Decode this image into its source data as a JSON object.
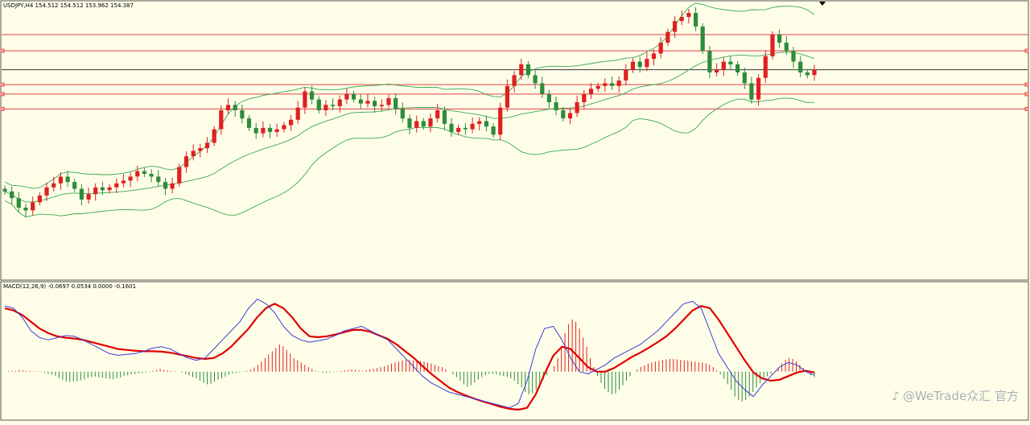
{
  "price_header": "USDJPY,H4  154.512 154.512 153.962 154.387",
  "macd_header": "MACD(12,26,9) -0.0697 0.0534 0.0000 -0.1601",
  "watermark": "@WeTrade众汇 官方",
  "colors": {
    "background": "#fefee8",
    "bull": "#e02020",
    "bear": "#2e8b3a",
    "bands": "#3aa855",
    "macd_line": "#3b3bdb",
    "signal_line": "#e00000",
    "levels": "#e04040",
    "current_price": "#333333"
  },
  "chart_data": [
    {
      "type": "candlestick",
      "symbol": "USDJPY",
      "timeframe": "H4",
      "ylim": [
        147.3,
        157.3
      ],
      "bollinger_bands": true,
      "horizontal_levels": [
        156.2,
        155.6,
        154.35,
        154.0,
        153.45
      ],
      "current_price_level": 154.9,
      "candles": [
        [
          150.5,
          150.4
        ],
        [
          150.4,
          150.15
        ],
        [
          150.15,
          149.8
        ],
        [
          149.8,
          149.7
        ],
        [
          149.7,
          150.0
        ],
        [
          150.0,
          150.25
        ],
        [
          150.25,
          150.55
        ],
        [
          150.55,
          150.7
        ],
        [
          150.7,
          150.95
        ],
        [
          150.95,
          150.75
        ],
        [
          150.75,
          150.5
        ],
        [
          150.5,
          150.1
        ],
        [
          150.1,
          150.3
        ],
        [
          150.3,
          150.55
        ],
        [
          150.55,
          150.45
        ],
        [
          150.45,
          150.55
        ],
        [
          150.55,
          150.7
        ],
        [
          150.7,
          150.8
        ],
        [
          150.8,
          150.95
        ],
        [
          150.95,
          151.15
        ],
        [
          151.15,
          151.05
        ],
        [
          151.05,
          150.95
        ],
        [
          150.95,
          150.75
        ],
        [
          150.75,
          150.5
        ],
        [
          150.5,
          150.7
        ],
        [
          150.7,
          151.3
        ],
        [
          151.3,
          151.7
        ],
        [
          151.7,
          151.9
        ],
        [
          151.9,
          152.0
        ],
        [
          152.0,
          152.2
        ],
        [
          152.2,
          152.7
        ],
        [
          152.7,
          153.4
        ],
        [
          153.4,
          153.6
        ],
        [
          153.6,
          153.4
        ],
        [
          153.4,
          153.1
        ],
        [
          153.1,
          152.75
        ],
        [
          152.75,
          152.55
        ],
        [
          152.55,
          152.75
        ],
        [
          152.75,
          152.6
        ],
        [
          152.6,
          152.7
        ],
        [
          152.7,
          152.85
        ],
        [
          152.85,
          153.05
        ],
        [
          153.05,
          153.5
        ],
        [
          153.5,
          154.1
        ],
        [
          154.1,
          153.8
        ],
        [
          153.8,
          153.4
        ],
        [
          153.4,
          153.6
        ],
        [
          153.6,
          153.55
        ],
        [
          153.55,
          153.8
        ],
        [
          153.8,
          154.0
        ],
        [
          154.0,
          153.8
        ],
        [
          153.8,
          153.65
        ],
        [
          153.65,
          153.75
        ],
        [
          153.75,
          153.55
        ],
        [
          153.55,
          153.6
        ],
        [
          153.6,
          153.85
        ],
        [
          153.85,
          153.45
        ],
        [
          153.45,
          153.1
        ],
        [
          153.1,
          152.75
        ],
        [
          152.75,
          153.0
        ],
        [
          153.0,
          152.8
        ],
        [
          152.8,
          153.1
        ],
        [
          153.1,
          153.4
        ],
        [
          153.4,
          152.9
        ],
        [
          152.9,
          152.6
        ],
        [
          152.6,
          152.75
        ],
        [
          152.75,
          152.7
        ],
        [
          152.7,
          152.9
        ],
        [
          152.9,
          153.0
        ],
        [
          153.0,
          152.8
        ],
        [
          152.8,
          152.5
        ],
        [
          152.5,
          153.5
        ],
        [
          153.5,
          154.3
        ],
        [
          154.3,
          154.7
        ],
        [
          154.7,
          155.1
        ],
        [
          155.1,
          154.7
        ],
        [
          154.7,
          154.4
        ],
        [
          154.4,
          154.0
        ],
        [
          154.0,
          153.7
        ],
        [
          153.7,
          153.4
        ],
        [
          153.4,
          153.1
        ],
        [
          153.1,
          153.3
        ],
        [
          153.3,
          153.7
        ],
        [
          153.7,
          154.0
        ],
        [
          154.0,
          154.2
        ],
        [
          154.2,
          154.3
        ],
        [
          154.3,
          154.4
        ],
        [
          154.4,
          154.3
        ],
        [
          154.3,
          154.5
        ],
        [
          154.5,
          154.9
        ],
        [
          154.9,
          155.2
        ],
        [
          155.2,
          155.0
        ],
        [
          155.0,
          155.3
        ],
        [
          155.3,
          155.5
        ],
        [
          155.5,
          155.9
        ],
        [
          155.9,
          156.3
        ],
        [
          156.3,
          156.7
        ],
        [
          156.7,
          156.85
        ],
        [
          156.85,
          157.0
        ],
        [
          157.0,
          156.5
        ],
        [
          156.5,
          155.6
        ],
        [
          155.6,
          154.8
        ],
        [
          154.8,
          154.9
        ],
        [
          154.9,
          155.2
        ],
        [
          155.2,
          155.1
        ],
        [
          155.1,
          154.8
        ],
        [
          154.8,
          154.4
        ],
        [
          154.4,
          153.8
        ],
        [
          153.8,
          154.6
        ],
        [
          154.6,
          155.4
        ],
        [
          155.4,
          156.2
        ],
        [
          156.2,
          155.9
        ],
        [
          155.9,
          155.6
        ],
        [
          155.6,
          155.2
        ],
        [
          155.2,
          154.8
        ],
        [
          154.8,
          154.7
        ],
        [
          154.7,
          154.9
        ]
      ]
    },
    {
      "type": "macd",
      "params": "12,26,9",
      "ylim": [
        -1.0,
        1.7
      ],
      "macd": [
        1.45,
        1.4,
        1.2,
        0.9,
        0.75,
        0.7,
        0.75,
        0.8,
        0.78,
        0.7,
        0.6,
        0.5,
        0.4,
        0.36,
        0.38,
        0.4,
        0.45,
        0.52,
        0.55,
        0.5,
        0.4,
        0.3,
        0.25,
        0.3,
        0.5,
        0.7,
        0.9,
        1.1,
        1.4,
        1.6,
        1.5,
        1.3,
        1.0,
        0.8,
        0.7,
        0.65,
        0.68,
        0.72,
        0.8,
        0.9,
        0.95,
        1.0,
        0.9,
        0.8,
        0.7,
        0.5,
        0.3,
        0.1,
        -0.1,
        -0.25,
        -0.35,
        -0.45,
        -0.5,
        -0.55,
        -0.6,
        -0.65,
        -0.7,
        -0.75,
        -0.8,
        -0.7,
        -0.2,
        0.5,
        0.95,
        1.0,
        0.7,
        0.3,
        0.0,
        -0.05,
        0.05,
        0.15,
        0.3,
        0.4,
        0.5,
        0.6,
        0.75,
        0.9,
        1.1,
        1.3,
        1.5,
        1.55,
        1.4,
        0.9,
        0.4,
        0.1,
        -0.2,
        -0.4,
        -0.55,
        -0.3,
        -0.1,
        0.1,
        0.2,
        0.15,
        0.0,
        -0.08
      ],
      "signal": [
        1.4,
        1.35,
        1.25,
        1.1,
        0.95,
        0.85,
        0.78,
        0.75,
        0.73,
        0.7,
        0.65,
        0.6,
        0.55,
        0.5,
        0.48,
        0.46,
        0.45,
        0.45,
        0.44,
        0.42,
        0.38,
        0.34,
        0.3,
        0.28,
        0.3,
        0.4,
        0.55,
        0.75,
        0.95,
        1.2,
        1.4,
        1.5,
        1.4,
        1.2,
        0.95,
        0.78,
        0.76,
        0.78,
        0.82,
        0.87,
        0.92,
        0.92,
        0.88,
        0.8,
        0.72,
        0.6,
        0.45,
        0.3,
        0.12,
        -0.05,
        -0.2,
        -0.35,
        -0.45,
        -0.53,
        -0.6,
        -0.66,
        -0.72,
        -0.78,
        -0.82,
        -0.84,
        -0.8,
        -0.5,
        -0.05,
        0.35,
        0.55,
        0.5,
        0.3,
        0.1,
        0.0,
        0.0,
        0.08,
        0.2,
        0.32,
        0.42,
        0.53,
        0.65,
        0.78,
        0.95,
        1.15,
        1.35,
        1.45,
        1.4,
        1.15,
        0.85,
        0.55,
        0.25,
        -0.02,
        -0.15,
        -0.2,
        -0.18,
        -0.1,
        -0.02,
        0.02,
        -0.02
      ],
      "histogram": [
        0.0,
        0.01,
        0.02,
        0.02,
        0.04,
        0.03,
        0.02,
        0.02,
        0.01,
        0.01,
        -0.01,
        -0.03,
        -0.05,
        -0.07,
        -0.1,
        -0.14,
        -0.18,
        -0.22,
        -0.23,
        -0.22,
        -0.21,
        -0.19,
        -0.17,
        -0.14,
        -0.12,
        -0.11,
        -0.12,
        -0.14,
        -0.15,
        -0.16,
        -0.17,
        -0.15,
        -0.13,
        -0.1,
        -0.08,
        -0.06,
        -0.05,
        -0.04,
        -0.03,
        -0.02,
        -0.01,
        0.02,
        0.04,
        0.06,
        0.04,
        0.03,
        0.02,
        0.01,
        0.0,
        -0.02,
        -0.05,
        -0.08,
        -0.12,
        -0.15,
        -0.2,
        -0.25,
        -0.28,
        -0.27,
        -0.22,
        -0.18,
        -0.15,
        -0.11,
        -0.07,
        -0.04,
        -0.03,
        -0.02,
        -0.01,
        0.02,
        0.05,
        0.09,
        0.15,
        0.22,
        0.3,
        0.38,
        0.45,
        0.52,
        0.6,
        0.56,
        0.48,
        0.4,
        0.3,
        0.25,
        0.2,
        0.15,
        0.1,
        0.06,
        0.02,
        -0.01,
        -0.02,
        -0.03,
        -0.02,
        -0.01,
        0.01,
        0.02,
        0.03,
        0.04,
        0.05,
        0.04,
        0.03,
        0.02,
        0.03,
        0.05,
        0.06,
        0.08,
        0.1,
        0.12,
        0.15,
        0.18,
        0.2,
        0.22,
        0.25,
        0.26,
        0.26,
        0.25,
        0.24,
        0.23,
        0.22,
        0.2,
        0.18,
        0.15,
        0.12,
        0.1,
        0.05,
        0.0,
        -0.06,
        -0.12,
        -0.2,
        -0.28,
        -0.33,
        -0.3,
        -0.24,
        -0.18,
        -0.12,
        -0.08,
        -0.05,
        -0.05,
        -0.06,
        -0.08,
        -0.1,
        -0.12,
        -0.15,
        -0.2,
        -0.28,
        -0.35,
        -0.45,
        -0.5,
        -0.48,
        -0.4,
        -0.3,
        -0.18,
        -0.08,
        0.0,
        0.12,
        0.3,
        0.55,
        0.85,
        1.05,
        1.15,
        1.1,
        0.95,
        0.75,
        0.55,
        0.3,
        0.1,
        -0.1,
        -0.25,
        -0.38,
        -0.45,
        -0.5,
        -0.48,
        -0.4,
        -0.3,
        -0.2,
        -0.1,
        0.0,
        0.05,
        0.1,
        0.14,
        0.18,
        0.2,
        0.22,
        0.24,
        0.26,
        0.27,
        0.28,
        0.28,
        0.27,
        0.26,
        0.25,
        0.24,
        0.23,
        0.22,
        0.21,
        0.2,
        0.18,
        0.15,
        0.1,
        0.03,
        -0.06,
        -0.16,
        -0.28,
        -0.4,
        -0.55,
        -0.62,
        -0.66,
        -0.63,
        -0.55,
        -0.45,
        -0.35,
        -0.25,
        -0.18,
        -0.1,
        -0.05,
        0.0,
        0.08,
        0.18,
        0.26,
        0.3,
        0.28,
        0.22,
        0.15,
        0.08,
        0.0,
        -0.08,
        -0.12
      ]
    }
  ]
}
